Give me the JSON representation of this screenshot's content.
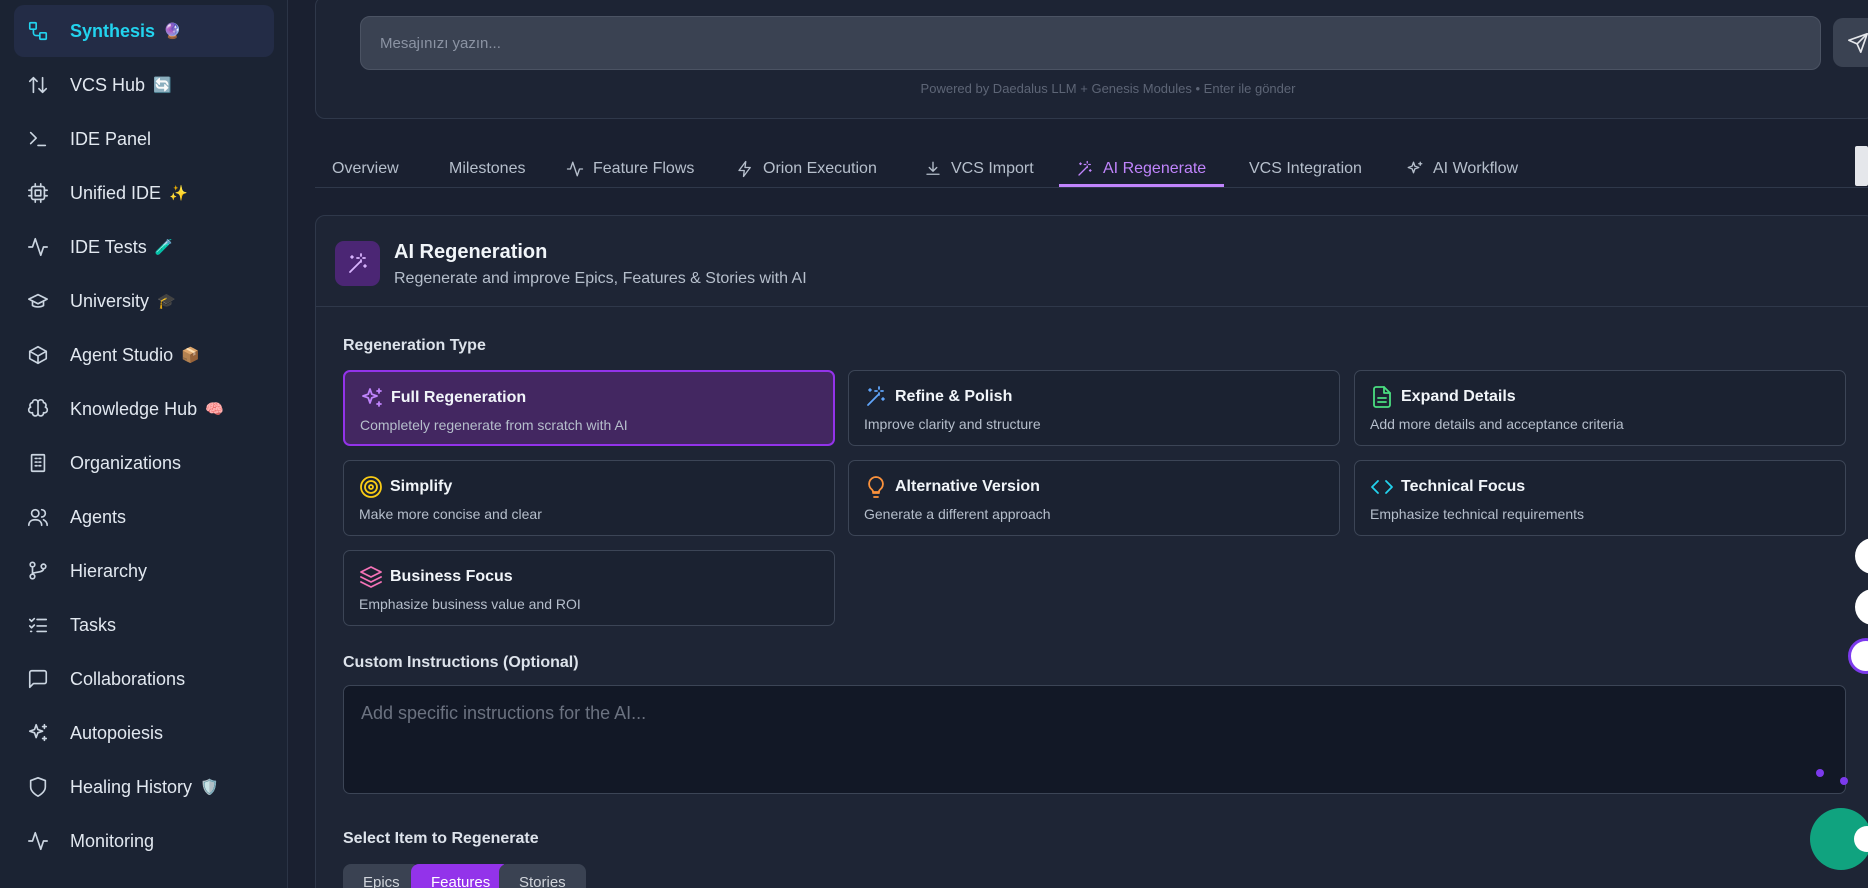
{
  "sidebar": {
    "items": [
      {
        "label": "Synthesis",
        "emoji": "🔮",
        "icon": "workflow-icon",
        "active": true
      },
      {
        "label": "VCS Hub",
        "emoji": "🔄",
        "icon": "arrows-updown-icon"
      },
      {
        "label": "IDE Panel",
        "emoji": "",
        "icon": "terminal-icon"
      },
      {
        "label": "Unified IDE",
        "emoji": "✨",
        "icon": "cpu-icon"
      },
      {
        "label": "IDE Tests",
        "emoji": "🧪",
        "icon": "activity-icon"
      },
      {
        "label": "University",
        "emoji": "🎓",
        "icon": "graduation-cap-icon"
      },
      {
        "label": "Agent Studio",
        "emoji": "📦",
        "icon": "box-icon"
      },
      {
        "label": "Knowledge Hub",
        "emoji": "🧠",
        "icon": "brain-icon"
      },
      {
        "label": "Organizations",
        "emoji": "",
        "icon": "building-icon"
      },
      {
        "label": "Agents",
        "emoji": "",
        "icon": "users-icon"
      },
      {
        "label": "Hierarchy",
        "emoji": "",
        "icon": "git-branch-icon"
      },
      {
        "label": "Tasks",
        "emoji": "",
        "icon": "list-checks-icon"
      },
      {
        "label": "Collaborations",
        "emoji": "",
        "icon": "message-square-icon"
      },
      {
        "label": "Autopoiesis",
        "emoji": "",
        "icon": "sparkles-icon"
      },
      {
        "label": "Healing History",
        "emoji": "🛡️",
        "icon": "shield-icon"
      },
      {
        "label": "Monitoring",
        "emoji": "",
        "icon": "activity-icon"
      }
    ]
  },
  "chat": {
    "placeholder": "Mesajınızı yazın...",
    "powered_by": "Powered by Daedalus LLM + Genesis Modules • Enter ile gönder"
  },
  "tabs": [
    {
      "label": "Overview",
      "icon": ""
    },
    {
      "label": "Milestones",
      "icon": ""
    },
    {
      "label": "Feature Flows",
      "icon": "activity-icon"
    },
    {
      "label": "Orion Execution",
      "icon": "zap-icon"
    },
    {
      "label": "VCS Import",
      "icon": "download-icon"
    },
    {
      "label": "AI Regenerate",
      "icon": "wand-icon",
      "active": true
    },
    {
      "label": "VCS Integration",
      "icon": ""
    },
    {
      "label": "AI Workflow",
      "icon": "sparkles-icon"
    }
  ],
  "panel": {
    "title": "AI Regeneration",
    "subtitle": "Regenerate and improve Epics, Features & Stories with AI",
    "regeneration_type_label": "Regeneration Type",
    "options": [
      {
        "title": "Full Regeneration",
        "desc": "Completely regenerate from scratch with AI",
        "icon": "sparkles-icon",
        "color": "#c084fc",
        "selected": true
      },
      {
        "title": "Refine & Polish",
        "desc": "Improve clarity and structure",
        "icon": "wand-icon",
        "color": "#60a5fa"
      },
      {
        "title": "Expand Details",
        "desc": "Add more details and acceptance criteria",
        "icon": "file-text-icon",
        "color": "#4ade80"
      },
      {
        "title": "Simplify",
        "desc": "Make more concise and clear",
        "icon": "target-icon",
        "color": "#facc15"
      },
      {
        "title": "Alternative Version",
        "desc": "Generate a different approach",
        "icon": "lightbulb-icon",
        "color": "#fb923c"
      },
      {
        "title": "Technical Focus",
        "desc": "Emphasize technical requirements",
        "icon": "code-icon",
        "color": "#22d3ee"
      },
      {
        "title": "Business Focus",
        "desc": "Emphasize business value and ROI",
        "icon": "layers-icon",
        "color": "#f472b6"
      }
    ],
    "custom_label": "Custom Instructions (Optional)",
    "custom_placeholder": "Add specific instructions for the AI...",
    "select_label": "Select Item to Regenerate",
    "item_types": [
      {
        "label": "Epics"
      },
      {
        "label": "Features",
        "active": true
      },
      {
        "label": "Stories"
      }
    ]
  },
  "colors": {
    "accent": "#c084fc",
    "active_nav": "#22d3ee",
    "selected_border": "#9333ea"
  }
}
